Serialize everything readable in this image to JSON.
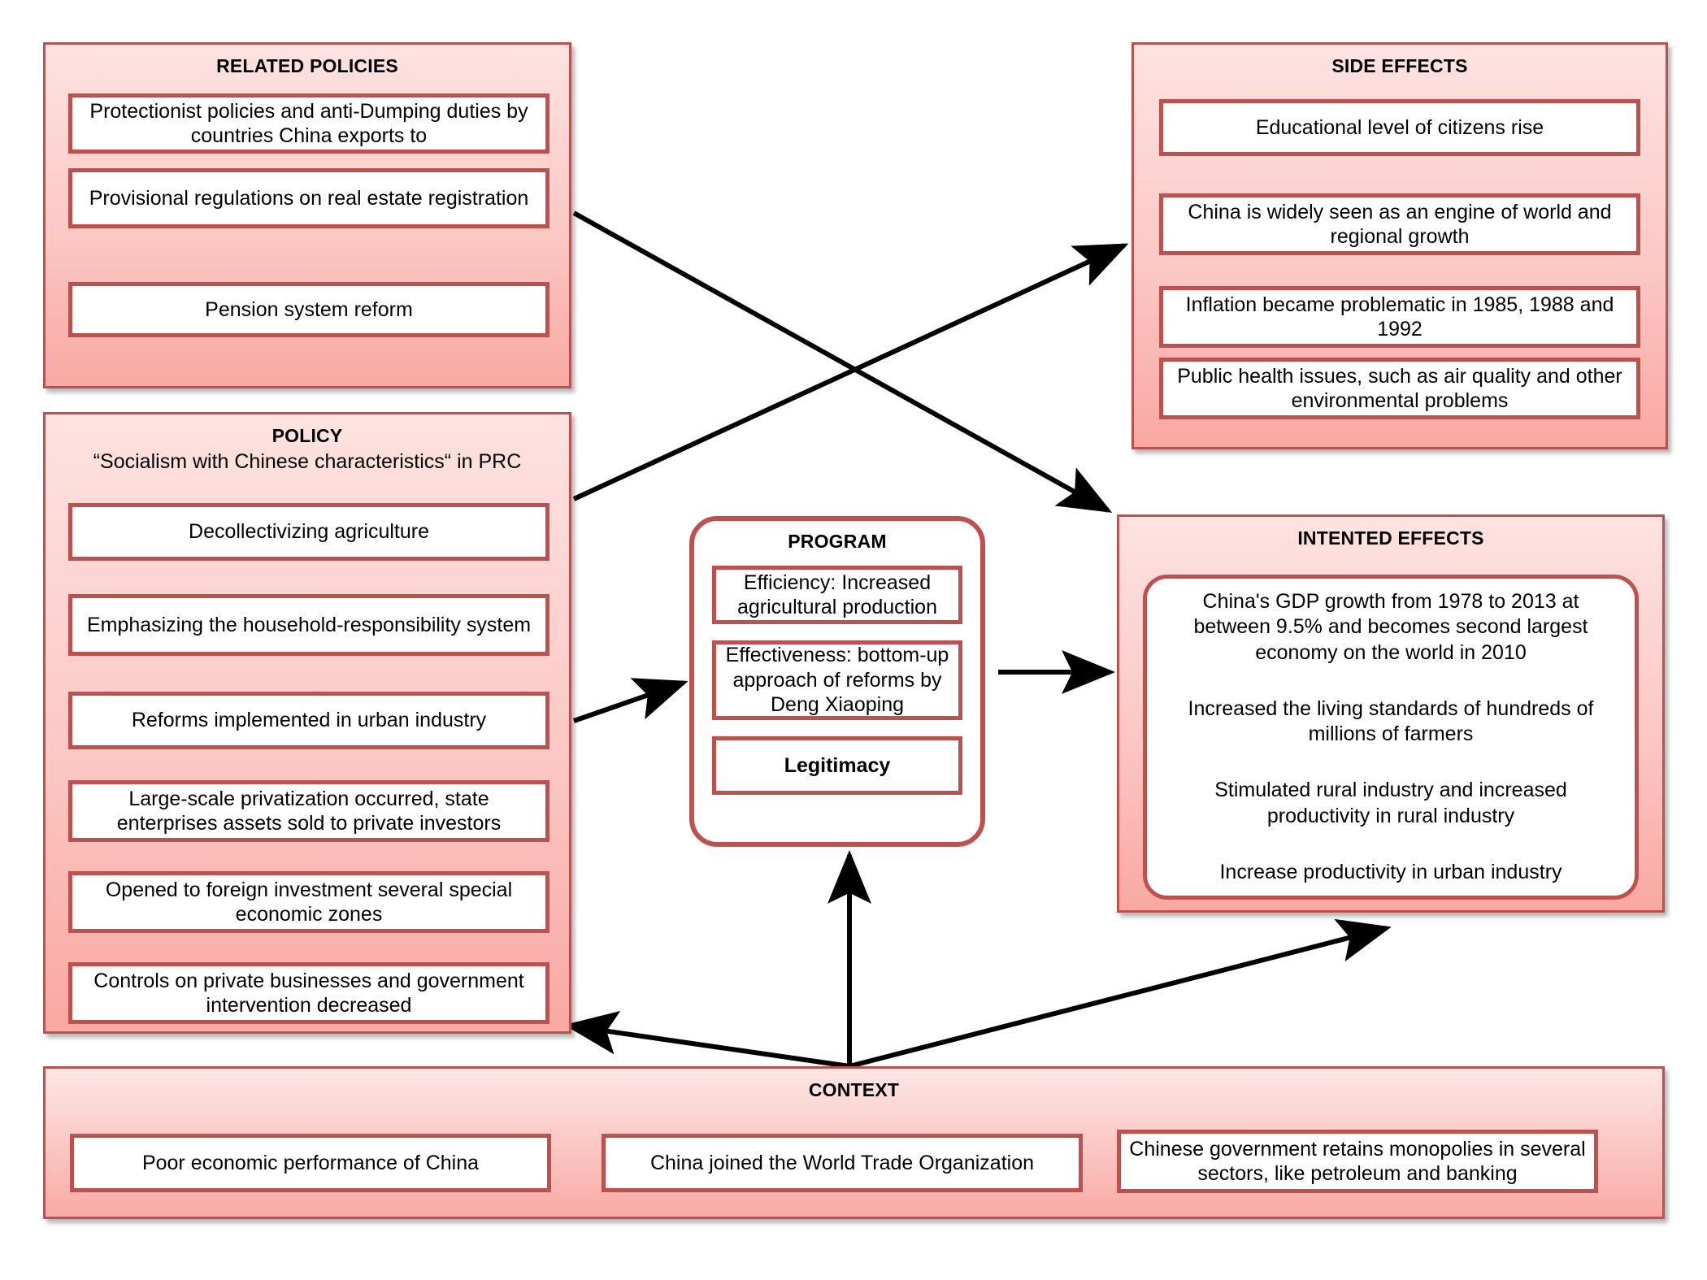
{
  "colors": {
    "border": "#c0504d",
    "panel_fill_light": "#fde3e1",
    "panel_fill_dark": "#f9a8a3",
    "item_fill": "#ffffff",
    "arrow": "#000000"
  },
  "related_policies": {
    "title": "RELATED POLICIES",
    "items": [
      "Protectionist  policies and anti-Dumping duties by countries China exports to",
      "Provisional regulations on real estate registration",
      "Pension system reform"
    ]
  },
  "side_effects": {
    "title": "SIDE  EFFECTS",
    "items": [
      "Educational level of citizens rise",
      "China is widely seen as an engine of world and regional growth",
      "Inflation became problematic in 1985, 1988 and 1992",
      "Public health issues, such as air quality and other environmental problems"
    ]
  },
  "policy": {
    "title": "POLICY",
    "subtitle": "“Socialism with Chinese characteristics“ in PRC",
    "items": [
      "Decollectivizing agriculture",
      "Emphasizing the household-responsibility system",
      "Reforms implemented in urban industry",
      "Large-scale privatization occurred, state enterprises assets sold to private investors",
      "Opened to foreign investment several special economic zones",
      "Controls on private businesses and government intervention decreased"
    ]
  },
  "program": {
    "title": "PROGRAM",
    "items": [
      "Efficiency:  Increased agricultural production",
      "Effectiveness: bottom-up approach of reforms by Deng Xiaoping",
      "Legitimacy"
    ]
  },
  "intented_effects": {
    "title": "INTENTED EFFECTS",
    "lines": [
      "China's GDP growth from 1978 to 2013 at between 9.5% and becomes second largest economy on the world in 2010",
      "Increased the living standards of hundreds of millions of farmers",
      "Stimulated rural industry and increased productivity in rural industry",
      "Increase productivity in urban industry"
    ]
  },
  "context": {
    "title": "CONTEXT",
    "items": [
      "Poor economic performance of China",
      "China joined the World Trade Organization",
      "Chinese government retains monopolies in several sectors,  like petroleum and banking"
    ]
  },
  "arrows": [
    {
      "name": "related-policies-to-intented-effects",
      "from": "RELATED POLICIES",
      "to": "INTENTED EFFECTS"
    },
    {
      "name": "policy-to-side-effects",
      "from": "POLICY",
      "to": "SIDE EFFECTS"
    },
    {
      "name": "policy-to-program",
      "from": "POLICY",
      "to": "PROGRAM"
    },
    {
      "name": "program-to-intented-effects",
      "from": "PROGRAM",
      "to": "INTENTED EFFECTS"
    },
    {
      "name": "context-to-program",
      "from": "CONTEXT",
      "to": "PROGRAM"
    },
    {
      "name": "context-to-policy",
      "from": "CONTEXT",
      "to": "POLICY"
    },
    {
      "name": "context-to-intented-effects",
      "from": "CONTEXT",
      "to": "INTENTED EFFECTS"
    }
  ]
}
